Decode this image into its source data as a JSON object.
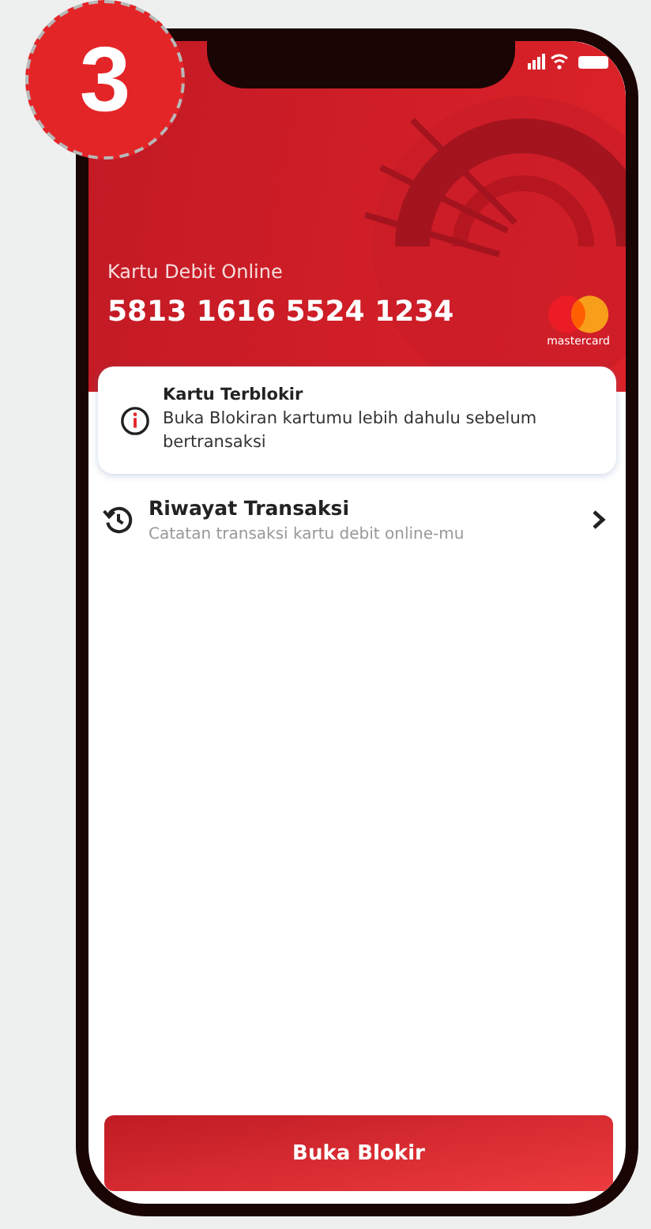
{
  "step_badge": "3",
  "card": {
    "label": "Kartu Debit Online",
    "number": "5813 1616 5524 1234",
    "brand": "mastercard"
  },
  "alert": {
    "title": "Kartu Terblokir",
    "message": "Buka Blokiran kartumu lebih dahulu sebelum bertransaksi"
  },
  "menu": [
    {
      "title": "Riwayat Transaksi",
      "subtitle": "Catatan transaksi kartu debit online-mu"
    }
  ],
  "button": "Buka Blokir"
}
